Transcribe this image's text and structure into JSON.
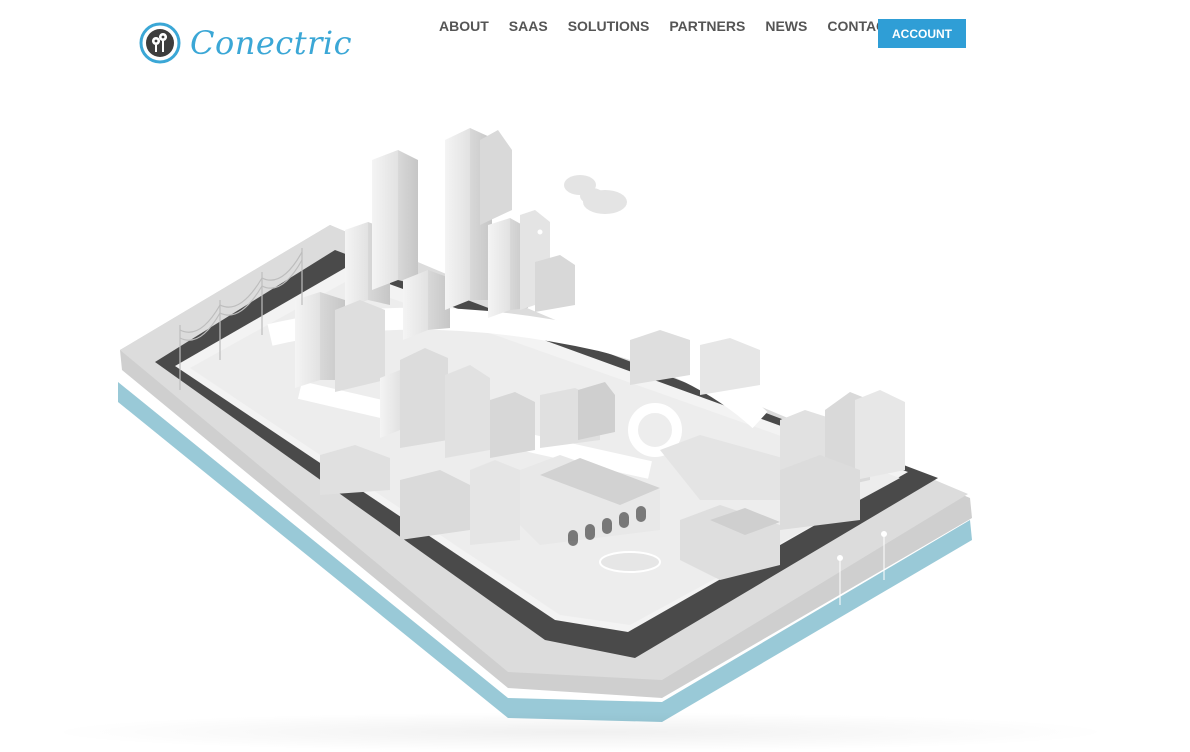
{
  "brand": {
    "name": "Conectric"
  },
  "nav": {
    "items": [
      "ABOUT",
      "SAAS",
      "SOLUTIONS",
      "PARTNERS",
      "NEWS",
      "CONTACT"
    ],
    "account_label": "ACCOUNT"
  },
  "colors": {
    "brand_blue": "#3ba7d6",
    "button_blue": "#2f9ed6",
    "nav_text": "#555555",
    "tablet_screen": "#4a4a4a",
    "tablet_shadow": "#8ec3d3"
  },
  "hero": {
    "image": "isometric-city-on-tablet-illustration"
  }
}
